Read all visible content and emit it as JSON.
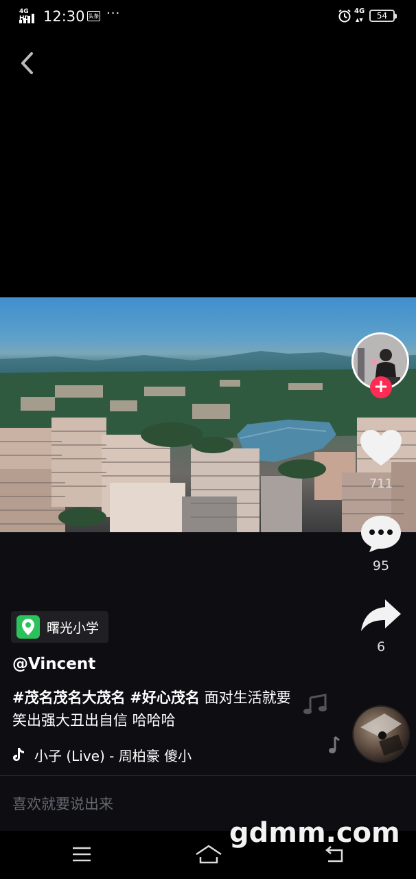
{
  "status_bar": {
    "network_label": "4G HD",
    "time": "12:30",
    "notification_badge": "头条",
    "more_dots": "···",
    "data_label": "4G",
    "battery_level": "54"
  },
  "side_actions": {
    "like_count": "711",
    "comment_count": "95",
    "share_count": "6",
    "follow_symbol": "+"
  },
  "post": {
    "location": "曙光小学",
    "username": "@Vincent",
    "hashtag_1": "#茂名茂名大茂名",
    "hashtag_2": "#好心茂名",
    "caption_text": "面对生活就要 笑出强大丑出自信 哈哈哈",
    "music_title": "小子 (Live) - 周柏豪    傻小"
  },
  "comment_bar": {
    "placeholder": "喜欢就要说出来"
  },
  "watermark": {
    "text": "gdmm.com"
  },
  "colors": {
    "follow_red": "#fe2c55",
    "location_green": "#2bc25c",
    "panel_bg": "#0d0d12"
  }
}
